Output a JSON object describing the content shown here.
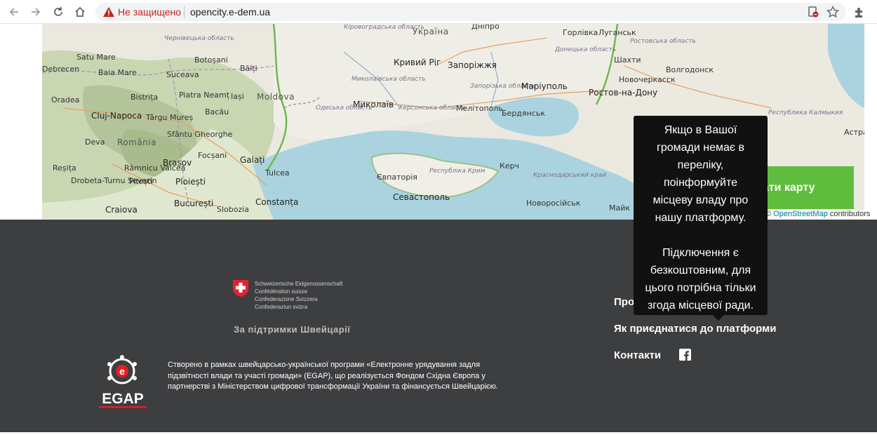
{
  "browser": {
    "back_icon": "back-arrow-icon",
    "forward_icon": "forward-arrow-icon",
    "reload_icon": "reload-icon",
    "home_icon": "home-icon",
    "security_label": "Не защищено",
    "url": "opencity.e-dem.ua",
    "colors": {
      "warning": "#c5221f"
    }
  },
  "map": {
    "labels": {
      "chernivetska": "Чернівецька область",
      "kirovohradska": "Кіровоградська область",
      "ukraina": "Україна",
      "dnipro": "Дніпро",
      "horlivka": "Горлівка",
      "luhansk": "Луганськ",
      "rostovska": "Ростовська область",
      "satu_mare": "Satu Mare",
      "botosani": "Botoșani",
      "debrecen": "Debrecen",
      "baia_mare": "Baia Mare",
      "balti": "Bălți",
      "suceava": "Suceava",
      "krivyi_rih": "Кривий Ріг",
      "zaporizhzhia": "Запоріжжя",
      "donetska": "Донецька область",
      "shakhty": "Шахти",
      "volgodonsk": "Волгодонск",
      "novocherkassk": "Новочеркасск",
      "oradea": "Oradea",
      "bistrita": "Bistrița",
      "piatra_neamt": "Piatra Neamț",
      "iasi": "Iași",
      "moldova": "Moldova",
      "mykolaivska": "Миколаївська область",
      "zaporizka": "Запорізька область",
      "mariupol": "Маріуполь",
      "rostov": "Ростов-на-Дону",
      "cluj": "Cluj-Napoca",
      "targu_mures": "Târgu Mureș",
      "bacau": "Bacău",
      "odeska": "Одеська область",
      "mykolaiv": "Миколаїв",
      "khersonska": "Херсонська область",
      "melitopol": "Мелітополь",
      "berdiansk": "Бердянськ",
      "kalmykia": "Республика Калмыкия",
      "sfantu": "Sfântu Gheorghe",
      "romania": "România",
      "deva": "Deva",
      "brasov": "Brașov",
      "focsani": "Focșani",
      "galati": "Galați",
      "tulcea": "Tulcea",
      "yevpatoriia": "Євпаторія",
      "krym": "Республіка Крим",
      "kerch": "Керч",
      "krasnodarskyi": "Краснодарський край",
      "astra": "Астра",
      "resita": "Reșița",
      "ramnicu": "Râmnicu Vâlcea",
      "pitesti": "Pitești",
      "ploiesti": "Ploiești",
      "drobeta": "Drobeta-Turnu Severin",
      "bucuresti": "București",
      "constanta": "Constanța",
      "sevastopol": "Севастополь",
      "novorossiisk": "Новоросійськ",
      "craiova": "Craiova",
      "slobozia": "Slobozia",
      "maik": "Майк"
    },
    "add_button_label": "Додати карту",
    "attribution_prefix": "©",
    "attribution_link": "OpenStreetMap",
    "attribution_suffix": "contributors"
  },
  "footer": {
    "swiss_lines": [
      "Schweizerische Eidgenossenschaft",
      "Confédération suisse",
      "Confederazione Svizzera",
      "Confederaziun svizra"
    ],
    "support_label": "За підтримки Швейцарії",
    "egap_label": "EGAP",
    "description": "Створено в рамках швейцарсько-української програми «Електронне урядування задля підзвітності влади та участі громади» (EGAP), що реалізується Фондом Східна Європа у партнерстві з Міністерством цифрової трансформації України та фінансується Швейцарією.",
    "links": {
      "about": "Про платформу",
      "join": "Як приєднатися до платформи",
      "contacts": "Контакти"
    }
  },
  "tooltip": {
    "line1": "Якщо в Вашої",
    "line2": "громади немає в",
    "line3": "переліку,",
    "line4": "поінформуйте",
    "line5": "місцеву владу про",
    "line6": "нашу платформу.",
    "line7": "Підключення є",
    "line8": "безкоштовним, для",
    "line9": "цього потрібна тільки",
    "line10": "згода місцевої ради."
  }
}
